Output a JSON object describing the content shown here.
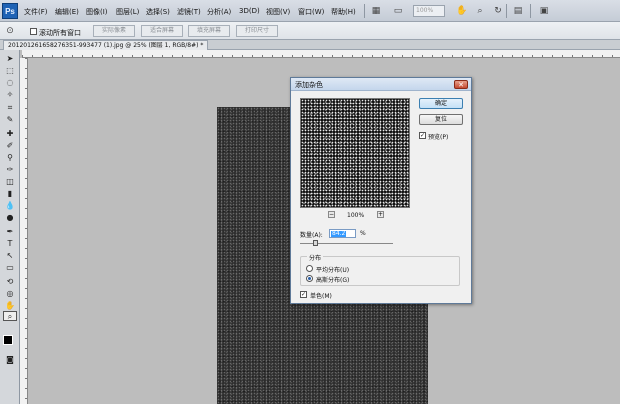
{
  "app": {
    "logo": "Ps"
  },
  "menu": [
    "文件(F)",
    "编辑(E)",
    "图像(I)",
    "图层(L)",
    "选择(S)",
    "滤镜(T)",
    "分析(A)",
    "3D(D)",
    "视图(V)",
    "窗口(W)",
    "帮助(H)"
  ],
  "zoom_field": "100%",
  "options_bar": {
    "scroll_all_windows": "滚动所有窗口",
    "actual_pixels": "实际像素",
    "fit_screen": "适合屏幕",
    "fill_screen": "填充屏幕",
    "print_size": "打印尺寸"
  },
  "document_tab": "201201261658276351-993477 (1).jpg @ 25% (图层 1, RGB/8#) *",
  "dialog": {
    "title": "添加杂色",
    "close": "✕",
    "ok": "确定",
    "reset": "复位",
    "preview_label": "预览(P)",
    "preview_checked": true,
    "zoom_minus": "−",
    "zoom_plus": "+",
    "zoom_level": "100%",
    "amount_label": "数量(A):",
    "amount_value": "84.2",
    "amount_unit": "%",
    "distribution_label": "分布",
    "uniform_label": "平均分布(U)",
    "gaussian_label": "高斯分布(G)",
    "selected_distribution": "gaussian",
    "mono_label": "单色(M)",
    "mono_checked": true
  }
}
